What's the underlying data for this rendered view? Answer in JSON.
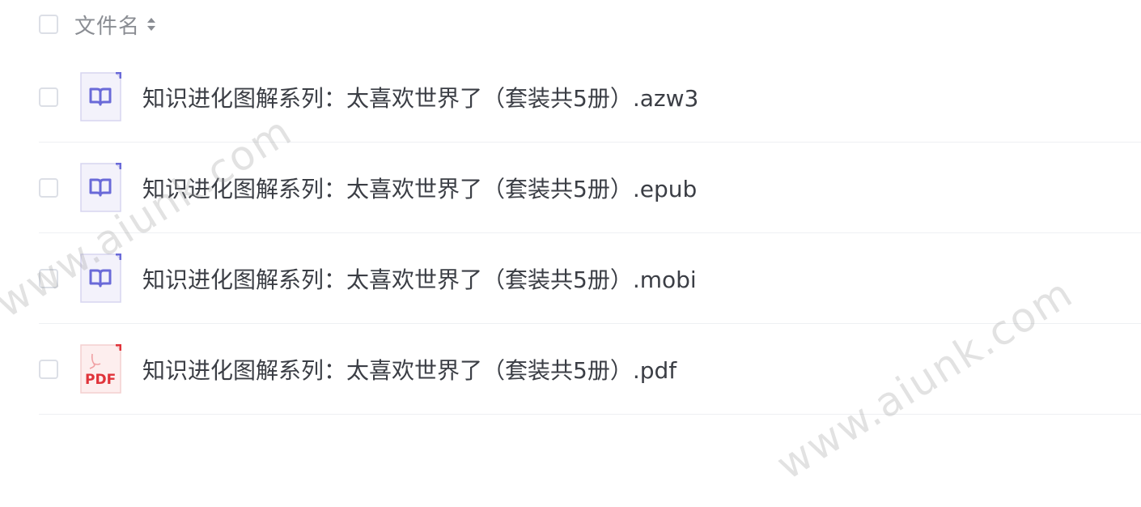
{
  "header": {
    "label": "文件名"
  },
  "files": [
    {
      "name": "知识进化图解系列：太喜欢世界了（套装共5册）.azw3",
      "icon": "ebook-icon"
    },
    {
      "name": "知识进化图解系列：太喜欢世界了（套装共5册）.epub",
      "icon": "ebook-icon"
    },
    {
      "name": "知识进化图解系列：太喜欢世界了（套装共5册）.mobi",
      "icon": "ebook-icon"
    },
    {
      "name": "知识进化图解系列：太喜欢世界了（套装共5册）.pdf",
      "icon": "pdf-icon",
      "icon_text": "PDF"
    }
  ],
  "watermark": {
    "text": "www.aiunk.com"
  },
  "colors": {
    "ebook_accent": "#6a6ad8",
    "ebook_bg": "#f3f2fb",
    "pdf_accent": "#e0333a",
    "pdf_bg": "#fdeeee"
  }
}
